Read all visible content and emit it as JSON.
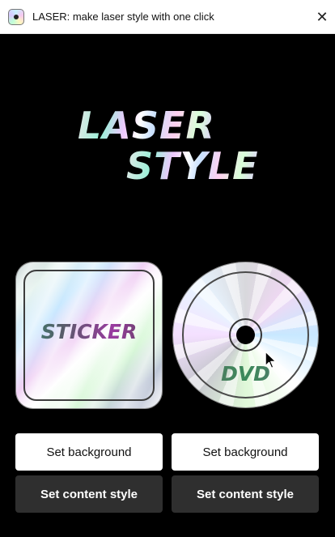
{
  "window": {
    "title": "LASER: make laser style with one click",
    "app_icon": "laser-disc-icon",
    "close_icon": "close-icon",
    "close_glyph": "✕"
  },
  "hero": {
    "line1": "LASER",
    "line2": "STYLE"
  },
  "previews": {
    "sticker_label": "STICKER",
    "disc_label": "DVD"
  },
  "buttons": {
    "sticker_background": "Set background",
    "sticker_content": "Set content style",
    "disc_background": "Set background",
    "disc_content": "Set content style"
  },
  "colors": {
    "background": "#000000",
    "titlebar": "#ffffff",
    "button_light": "#ffffff",
    "button_dark": "#2f2f2f"
  }
}
